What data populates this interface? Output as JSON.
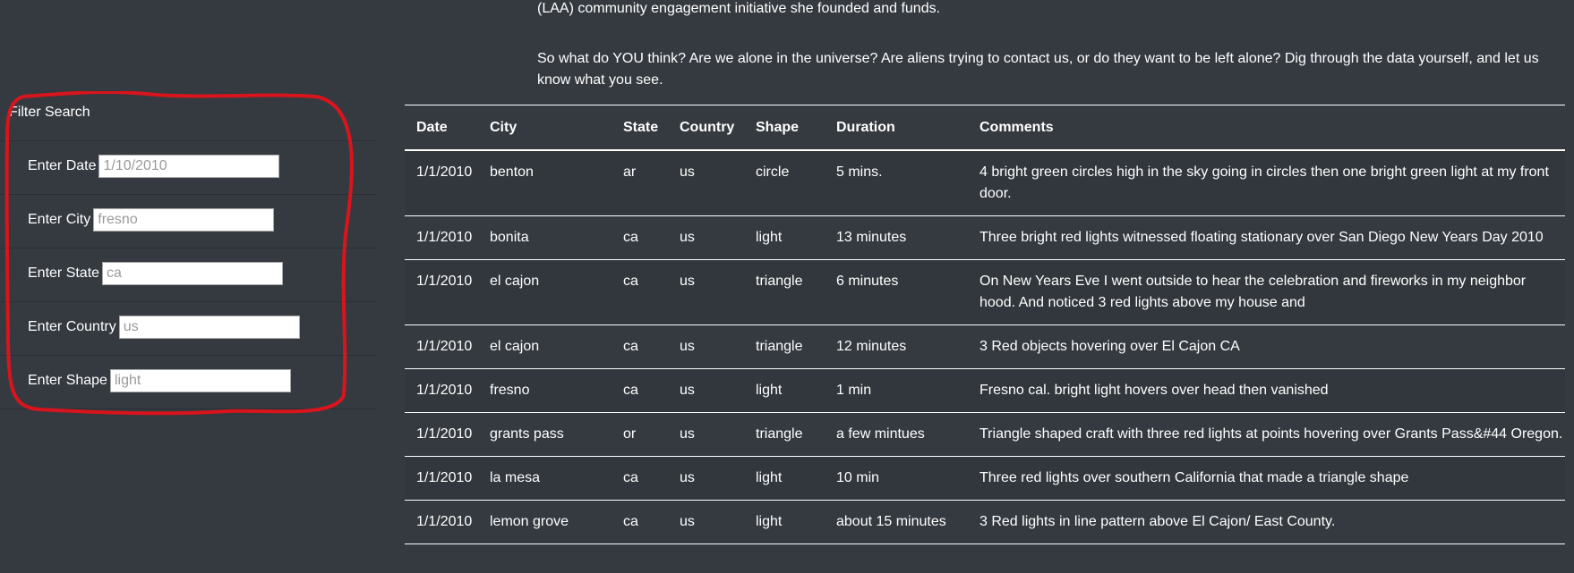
{
  "intro": {
    "line1": "(LAA) community engagement initiative she founded and funds.",
    "para2": "So what do YOU think? Are we alone in the universe? Are aliens trying to contact us, or do they want to be left alone? Dig through the data yourself, and let us know what you see."
  },
  "filters": {
    "heading": "Filter Search",
    "date": {
      "label": "Enter Date",
      "placeholder": "1/10/2010"
    },
    "city": {
      "label": "Enter City",
      "placeholder": "fresno"
    },
    "state": {
      "label": "Enter State",
      "placeholder": "ca"
    },
    "country": {
      "label": "Enter Country",
      "placeholder": "us"
    },
    "shape": {
      "label": "Enter Shape",
      "placeholder": "light"
    }
  },
  "table": {
    "headers": [
      "Date",
      "City",
      "State",
      "Country",
      "Shape",
      "Duration",
      "Comments"
    ],
    "rows": [
      [
        "1/1/2010",
        "benton",
        "ar",
        "us",
        "circle",
        "5 mins.",
        "4 bright green circles high in the sky going in circles then one bright green light at my front door."
      ],
      [
        "1/1/2010",
        "bonita",
        "ca",
        "us",
        "light",
        "13 minutes",
        "Three bright red lights witnessed floating stationary over San Diego New Years Day 2010"
      ],
      [
        "1/1/2010",
        "el cajon",
        "ca",
        "us",
        "triangle",
        "6 minutes",
        "On New Years Eve I went outside to hear the celebration and fireworks in my neighbor hood. And noticed 3 red lights above my house and"
      ],
      [
        "1/1/2010",
        "el cajon",
        "ca",
        "us",
        "triangle",
        "12 minutes",
        "3 Red objects hovering over El Cajon CA"
      ],
      [
        "1/1/2010",
        "fresno",
        "ca",
        "us",
        "light",
        "1 min",
        "Fresno cal. bright light hovers over head then vanished"
      ],
      [
        "1/1/2010",
        "grants pass",
        "or",
        "us",
        "triangle",
        "a few mintues",
        "Triangle shaped craft with three red lights at points hovering over Grants Pass&#44 Oregon."
      ],
      [
        "1/1/2010",
        "la mesa",
        "ca",
        "us",
        "light",
        "10 min",
        "Three red lights over southern California that made a triangle shape"
      ],
      [
        "1/1/2010",
        "lemon grove",
        "ca",
        "us",
        "light",
        "about 15 minutes",
        "3 Red lights in line pattern above El Cajon/ East County."
      ]
    ]
  },
  "colors": {
    "background": "#353a41",
    "annotation": "#d9141c",
    "text": "#ffffff"
  }
}
